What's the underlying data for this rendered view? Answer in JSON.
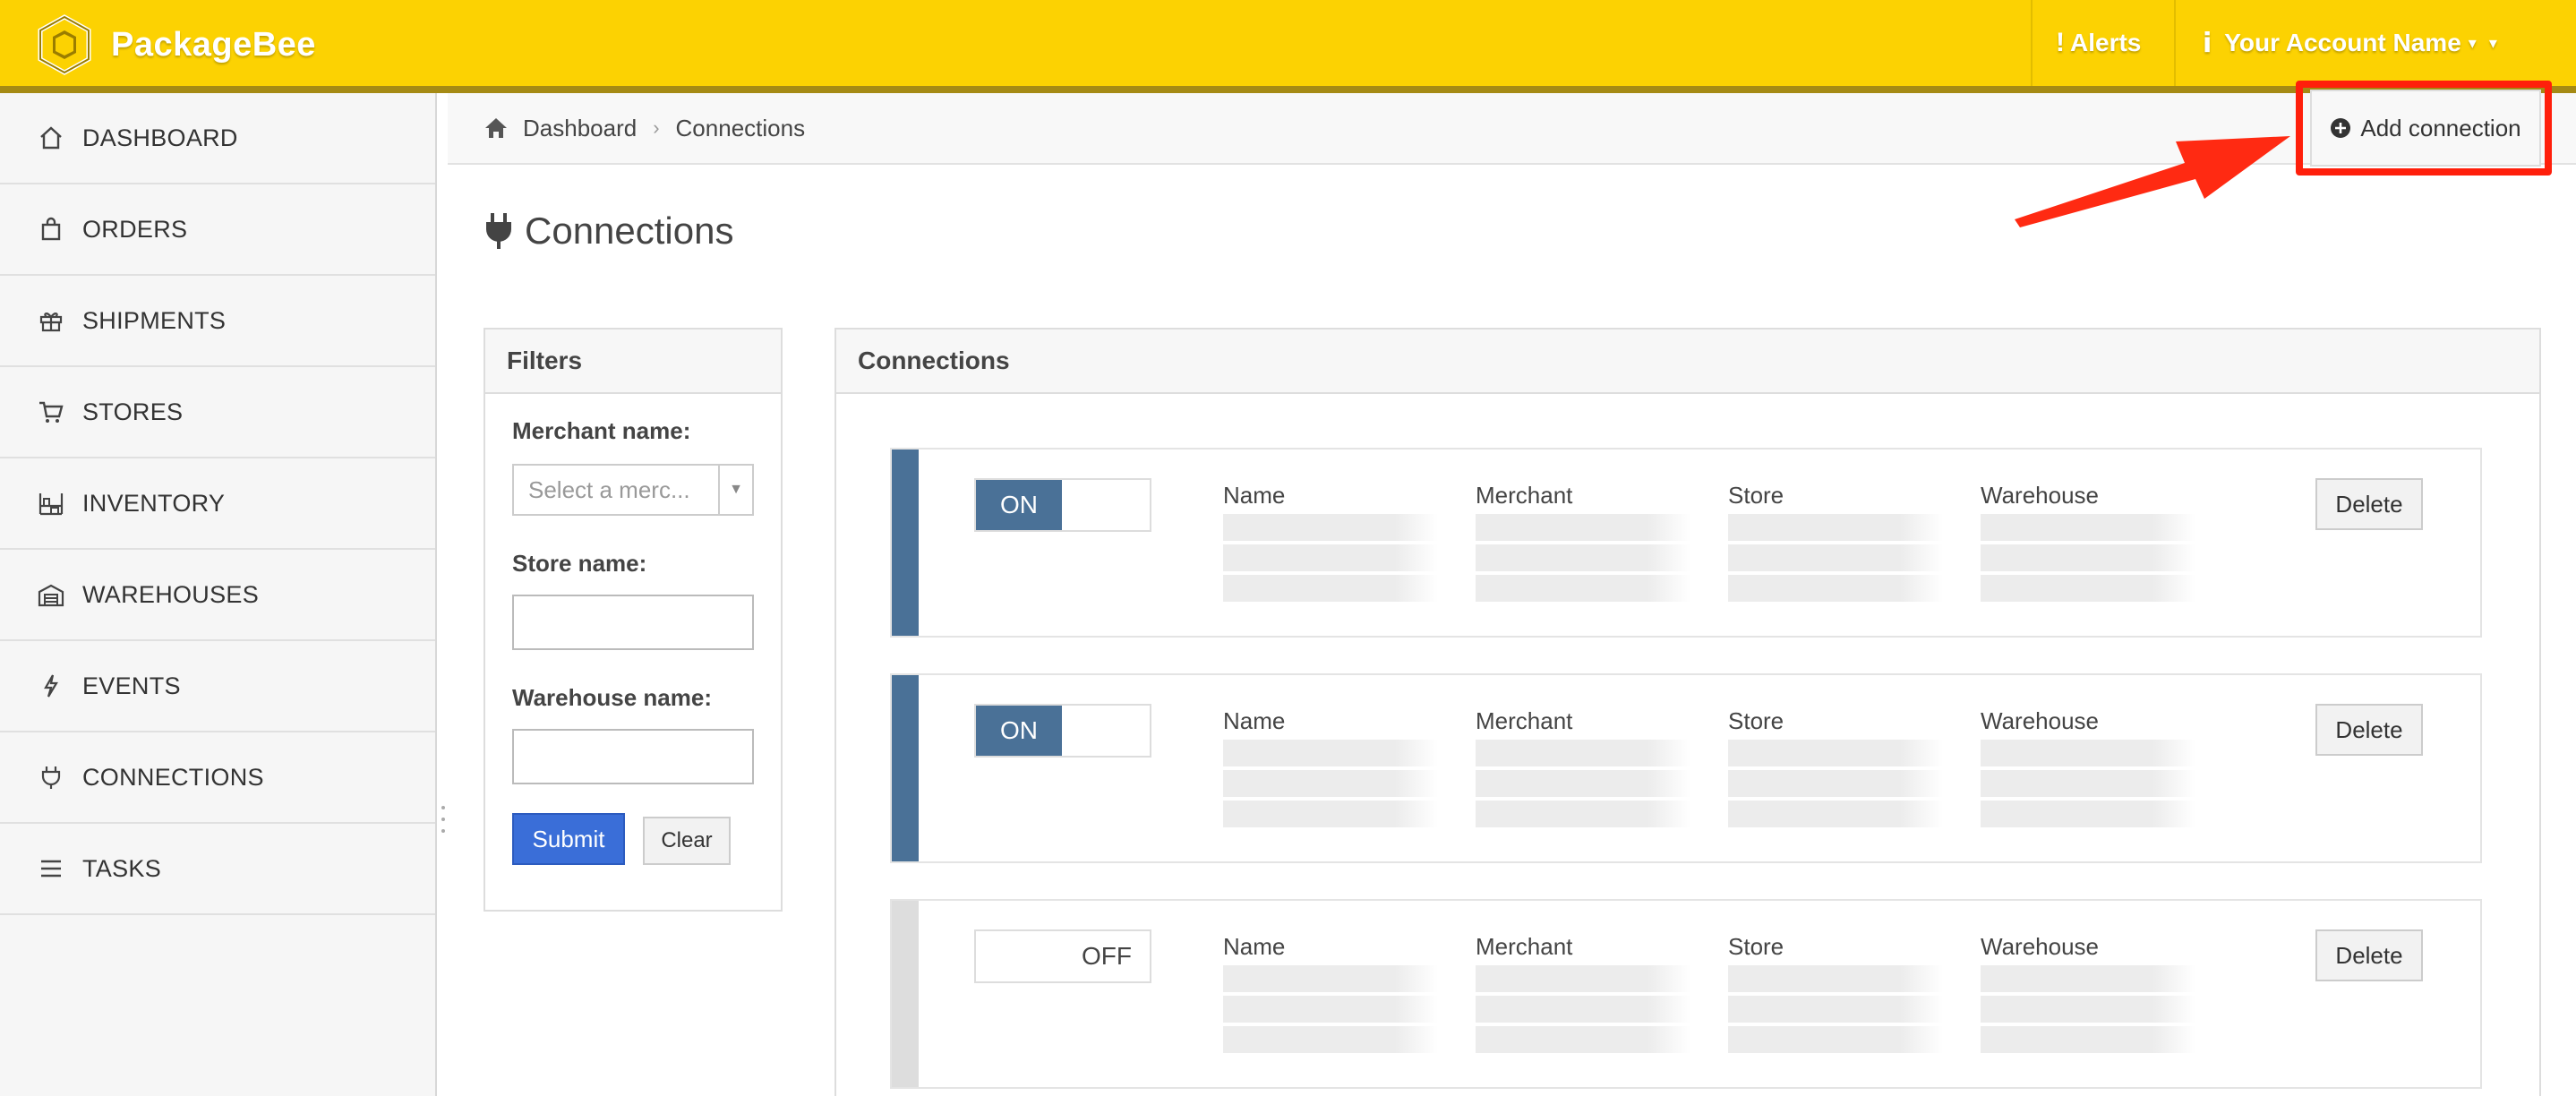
{
  "app": {
    "name": "PackageBee"
  },
  "topbar": {
    "alerts": "Alerts",
    "account": "Your Account Name"
  },
  "sidebar": {
    "items": [
      {
        "label": "DASHBOARD",
        "icon": "home-icon"
      },
      {
        "label": "ORDERS",
        "icon": "bag-icon"
      },
      {
        "label": "SHIPMENTS",
        "icon": "gift-box-icon"
      },
      {
        "label": "STORES",
        "icon": "cart-icon"
      },
      {
        "label": "INVENTORY",
        "icon": "shelves-icon"
      },
      {
        "label": "WAREHOUSES",
        "icon": "warehouse-icon"
      },
      {
        "label": "EVENTS",
        "icon": "bolt-icon"
      },
      {
        "label": "CONNECTIONS",
        "icon": "plug-icon"
      },
      {
        "label": "TASKS",
        "icon": "list-icon"
      }
    ]
  },
  "breadcrumb": {
    "home": "Dashboard",
    "current": "Connections"
  },
  "actions": {
    "add_connection": "Add connection"
  },
  "page": {
    "title": "Connections"
  },
  "filters": {
    "title": "Filters",
    "merchant_label": "Merchant name:",
    "merchant_placeholder": "Select a merc...",
    "store_label": "Store name:",
    "warehouse_label": "Warehouse name:",
    "submit": "Submit",
    "clear": "Clear"
  },
  "connections": {
    "title": "Connections",
    "columns": {
      "name": "Name",
      "merchant": "Merchant",
      "store": "Store",
      "warehouse": "Warehouse"
    },
    "delete_label": "Delete",
    "items": [
      {
        "state": "ON"
      },
      {
        "state": "ON"
      },
      {
        "state": "OFF"
      }
    ]
  },
  "colors": {
    "brand": "#fcd202",
    "accent": "#4a7197",
    "submit": "#3a6ed8",
    "highlight": "#ff1f0b"
  }
}
